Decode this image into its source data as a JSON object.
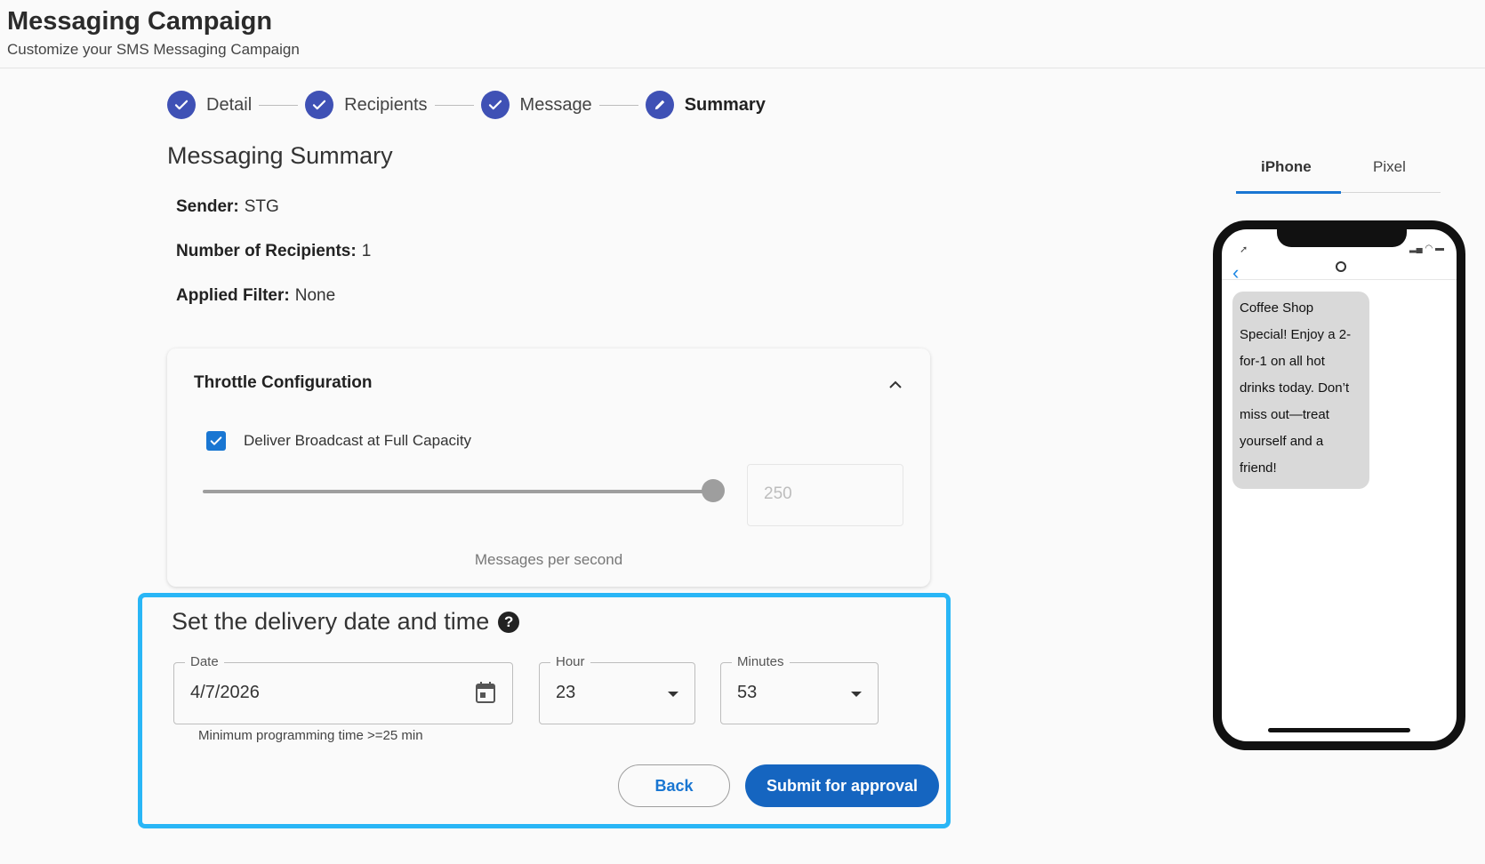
{
  "header": {
    "title": "Messaging Campaign",
    "subtitle": "Customize your SMS Messaging Campaign"
  },
  "stepper": {
    "steps": [
      {
        "label": "Detail",
        "state": "complete"
      },
      {
        "label": "Recipients",
        "state": "complete"
      },
      {
        "label": "Message",
        "state": "complete"
      },
      {
        "label": "Summary",
        "state": "active"
      }
    ]
  },
  "summary": {
    "title": "Messaging Summary",
    "sender_label": "Sender:",
    "sender_value": "STG",
    "recipients_label": "Number of Recipients:",
    "recipients_value": "1",
    "filter_label": "Applied Filter:",
    "filter_value": "None"
  },
  "throttle": {
    "title": "Throttle Configuration",
    "checkbox_label": "Deliver Broadcast at Full Capacity",
    "checkbox_checked": true,
    "slider_fraction": 1.0,
    "rate_value": "250",
    "rate_caption": "Messages per second"
  },
  "delivery": {
    "title": "Set the delivery date and time",
    "help_glyph": "?",
    "date_label": "Date",
    "date_value": "4/7/2026",
    "hour_label": "Hour",
    "hour_value": "23",
    "minutes_label": "Minutes",
    "minutes_value": "53",
    "hint": "Minimum programming time >=25 min",
    "back_label": "Back",
    "submit_label": "Submit for approval"
  },
  "preview": {
    "tabs": [
      "iPhone",
      "Pixel"
    ],
    "active_tab": "iPhone",
    "message": "Coffee Shop Special! Enjoy a 2-for-1 on all hot drinks today. Don’t miss out—treat yourself and a friend!"
  },
  "colors": {
    "accent": "#3f51b5",
    "primary_button": "#1565c0",
    "highlight_border": "#29b6f6"
  }
}
